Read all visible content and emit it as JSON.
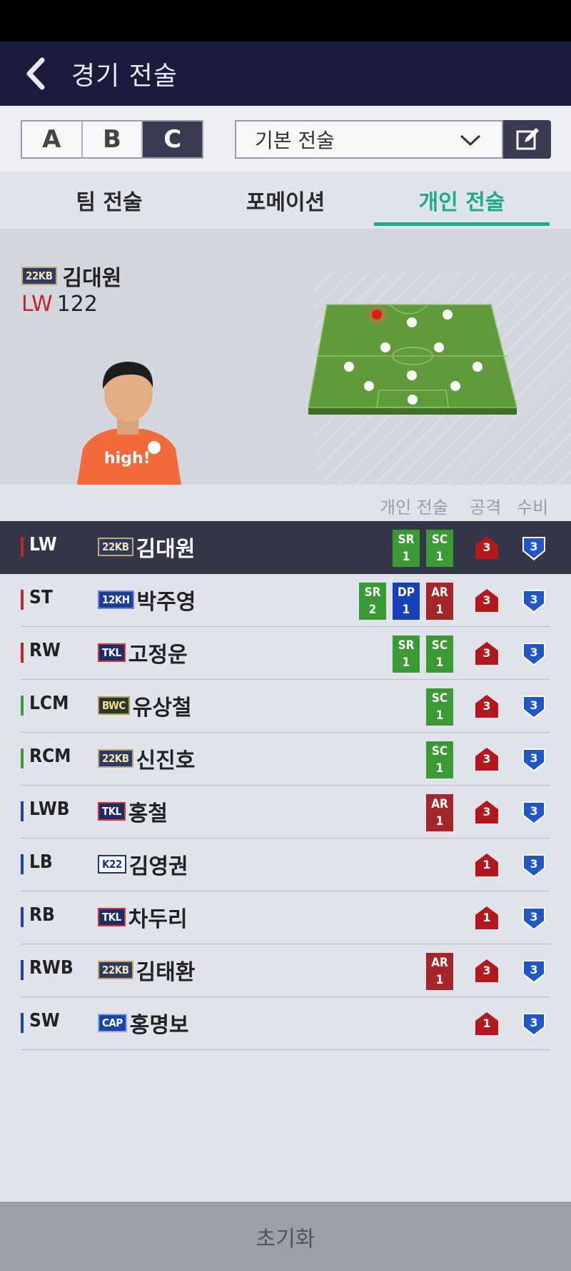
{
  "header": {
    "title": "경기 전술"
  },
  "presets": {
    "items": [
      "A",
      "B",
      "C"
    ],
    "active": "C"
  },
  "tactic_select": {
    "value": "기본 전술"
  },
  "tabs": [
    {
      "label": "팀 전술",
      "active": false
    },
    {
      "label": "포메이션",
      "active": false
    },
    {
      "label": "개인 전술",
      "active": true
    }
  ],
  "selected_player": {
    "season": "22KB",
    "name": "김대원",
    "position": "LW",
    "ovr": "122"
  },
  "list_header": {
    "individual": "개인 전술",
    "attack": "공격",
    "defense": "수비"
  },
  "players": [
    {
      "pos": "LW",
      "pos_color": "#c0262c",
      "season": "22KB",
      "name": "김대원",
      "chips": [
        {
          "code": "SR",
          "n": "1"
        },
        {
          "code": "SC",
          "n": "1"
        }
      ],
      "attack": "3",
      "defense": "3",
      "selected": true
    },
    {
      "pos": "ST",
      "pos_color": "#c0262c",
      "season": "12KH",
      "name": "박주영",
      "chips": [
        {
          "code": "SR",
          "n": "2"
        },
        {
          "code": "DP",
          "n": "1"
        },
        {
          "code": "AR",
          "n": "1"
        }
      ],
      "attack": "3",
      "defense": "3"
    },
    {
      "pos": "RW",
      "pos_color": "#c0262c",
      "season": "TKL",
      "name": "고정운",
      "chips": [
        {
          "code": "SR",
          "n": "1"
        },
        {
          "code": "SC",
          "n": "1"
        }
      ],
      "attack": "3",
      "defense": "3"
    },
    {
      "pos": "LCM",
      "pos_color": "#3b9a33",
      "season": "BWC",
      "name": "유상철",
      "chips": [
        {
          "code": "SC",
          "n": "1"
        }
      ],
      "attack": "3",
      "defense": "3"
    },
    {
      "pos": "RCM",
      "pos_color": "#3b9a33",
      "season": "22KB",
      "name": "신진호",
      "chips": [
        {
          "code": "SC",
          "n": "1"
        }
      ],
      "attack": "3",
      "defense": "3"
    },
    {
      "pos": "LWB",
      "pos_color": "#1c45a8",
      "season": "TKL",
      "name": "홍철",
      "chips": [
        {
          "code": "AR",
          "n": "1"
        }
      ],
      "attack": "3",
      "defense": "3"
    },
    {
      "pos": "LB",
      "pos_color": "#1c45a8",
      "season": "K22",
      "name": "김영권",
      "chips": [],
      "attack": "1",
      "defense": "3"
    },
    {
      "pos": "RB",
      "pos_color": "#1c45a8",
      "season": "TKL",
      "name": "차두리",
      "chips": [],
      "attack": "1",
      "defense": "3"
    },
    {
      "pos": "RWB",
      "pos_color": "#1c45a8",
      "season": "22KB",
      "name": "김태환",
      "chips": [
        {
          "code": "AR",
          "n": "1"
        }
      ],
      "attack": "3",
      "defense": "3"
    },
    {
      "pos": "SW",
      "pos_color": "#1c45a8",
      "season": "CAP",
      "name": "홍명보",
      "chips": [],
      "attack": "1",
      "defense": "3"
    }
  ],
  "reset_button": {
    "label": "초기화"
  },
  "colors": {
    "accent": "#1bab8c",
    "header_bg": "#1b1b3d",
    "attack": "#b3181d",
    "defense": "#1f57c8"
  },
  "icons": {
    "back": "chevron-left-icon",
    "dropdown": "chevron-down-icon",
    "edit": "edit-icon"
  }
}
